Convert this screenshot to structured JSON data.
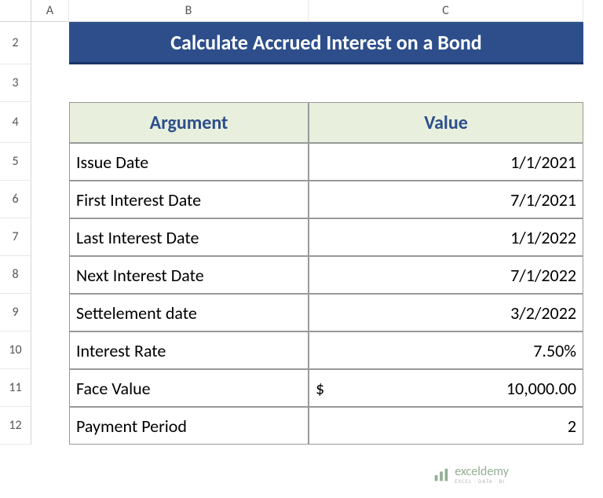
{
  "columns": [
    "A",
    "B",
    "C"
  ],
  "rows": [
    "2",
    "3",
    "4",
    "5",
    "6",
    "7",
    "8",
    "9",
    "10",
    "11",
    "12"
  ],
  "title": "Calculate Accrued Interest on a Bond",
  "header": {
    "argument": "Argument",
    "value": "Value"
  },
  "data": [
    {
      "label": "Issue Date",
      "value": "1/1/2021"
    },
    {
      "label": "First Interest Date",
      "value": "7/1/2021"
    },
    {
      "label": "Last Interest Date",
      "value": "1/1/2022"
    },
    {
      "label": "Next Interest Date",
      "value": "7/1/2022"
    },
    {
      "label": "Settelement date",
      "value": "3/2/2022"
    },
    {
      "label": "Interest Rate",
      "value": "7.50%"
    },
    {
      "label": "Face Value",
      "currency": "$",
      "value": "10,000.00"
    },
    {
      "label": "Payment Period",
      "value": "2"
    }
  ],
  "watermark": {
    "main": "exceldemy",
    "sub": "EXCEL · DATA · BI"
  },
  "chart_data": {
    "type": "table",
    "title": "Calculate Accrued Interest on a Bond",
    "columns": [
      "Argument",
      "Value"
    ],
    "rows": [
      [
        "Issue Date",
        "1/1/2021"
      ],
      [
        "First Interest Date",
        "7/1/2021"
      ],
      [
        "Last Interest Date",
        "1/1/2022"
      ],
      [
        "Next Interest Date",
        "7/1/2022"
      ],
      [
        "Settelement date",
        "3/2/2022"
      ],
      [
        "Interest Rate",
        "7.50%"
      ],
      [
        "Face Value",
        "$ 10,000.00"
      ],
      [
        "Payment Period",
        "2"
      ]
    ]
  }
}
